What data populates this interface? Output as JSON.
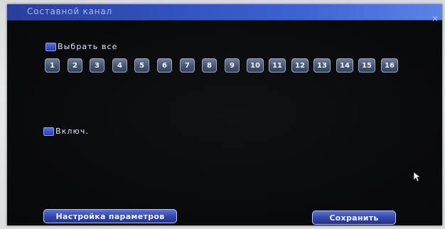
{
  "window": {
    "title": "Составной канал",
    "close_glyph": "×"
  },
  "select_all": {
    "label": "Выбрать все",
    "checked": true
  },
  "channels": [
    "1",
    "2",
    "3",
    "4",
    "5",
    "6",
    "7",
    "8",
    "9",
    "10",
    "11",
    "12",
    "13",
    "14",
    "15",
    "16"
  ],
  "enable": {
    "label": "Включ.",
    "checked": true
  },
  "footer": {
    "settings_label": "Настройка параметров",
    "save_label": "Сохранить"
  },
  "colors": {
    "titlebar": "#2f4fb7",
    "dialog_bg": "#0b0c0e",
    "button_blue": "#3245a6",
    "channel_button": "#475571"
  },
  "icons": {
    "checkbox": "checkbox-icon",
    "close": "close-icon",
    "cursor": "mouse-cursor-icon"
  }
}
